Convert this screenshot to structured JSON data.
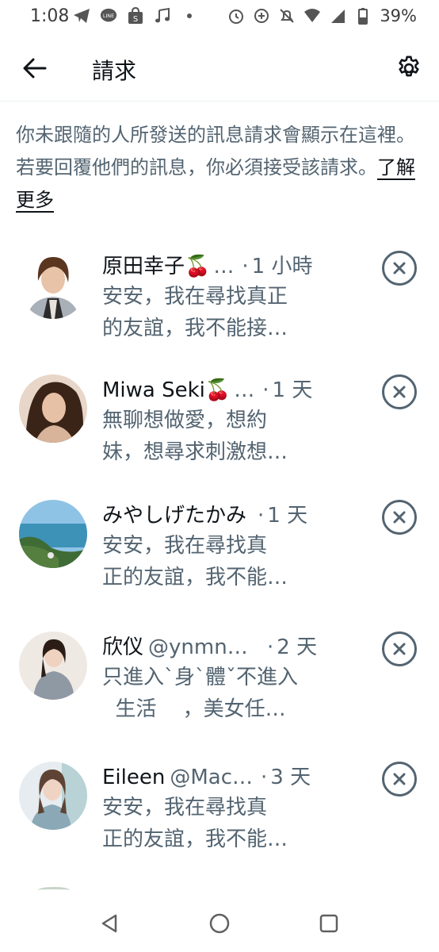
{
  "status_bar": {
    "time": "1:08",
    "battery": "39%",
    "left_icons": [
      "telegram-icon",
      "line-icon",
      "shopee-icon",
      "music-icon",
      "dot-icon"
    ],
    "right_icons": [
      "alarm-icon",
      "data-saver-icon",
      "mute-icon",
      "wifi-icon",
      "signal-icon",
      "battery-icon"
    ]
  },
  "header": {
    "title": "請求",
    "back_icon": "arrow-left-icon",
    "settings_icon": "gear-icon"
  },
  "intro": {
    "text": "你未跟隨的人所發送的訊息請求會顯示在這裡。若要回覆他們的訊息，你必須接受該請求。",
    "learn_more": "了解更多"
  },
  "requests": [
    {
      "name": "原田幸子🍒",
      "handle": "",
      "ellipsis": "…",
      "time": "1 小時",
      "message": "安安，我在尋找真正\n的友誼，我不能接…"
    },
    {
      "name": "Miwa Seki🍒",
      "handle": "",
      "ellipsis": "…",
      "time": "1 天",
      "message": "無聊想做愛，想約\n妹，想尋求刺激想…"
    },
    {
      "name": "みやしげたかみ",
      "handle": "",
      "ellipsis": "",
      "time": "1 天",
      "message": "安安，我在尋找真\n正的友誼，我不能…"
    },
    {
      "name": "欣仪",
      "handle": "@ynmng…",
      "ellipsis": "",
      "time": "2 天",
      "message": "只進入ˋ身ˋ體ˇ不進入\n  生活    ，美女任…"
    },
    {
      "name": "Eileen",
      "handle": "@Mac…",
      "ellipsis": "",
      "time": "3 天",
      "message": "安安，我在尋找真\n正的友誼，我不能…"
    }
  ],
  "reject_icon": "close-circle-icon",
  "nav_bar": {
    "icons": [
      "back-triangle-icon",
      "home-circle-icon",
      "recents-square-icon"
    ]
  }
}
